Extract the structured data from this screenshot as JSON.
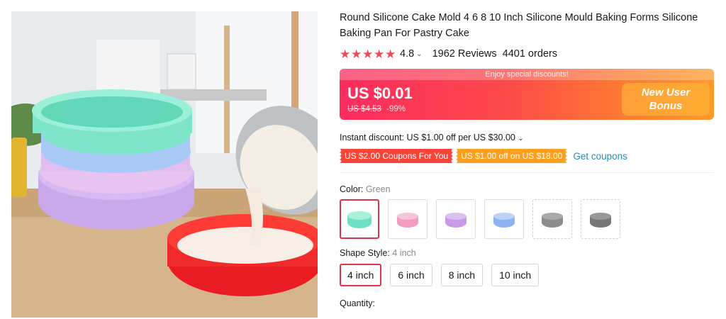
{
  "product": {
    "title": "Round Silicone Cake Mold 4 6 8 10 Inch Silicone Mould Baking Forms Silicone Baking Pan For Pastry Cake",
    "image_alt": "product-photo"
  },
  "rating": {
    "stars": 5,
    "value": "4.8",
    "reviews": "1962 Reviews",
    "orders": "4401 orders"
  },
  "price": {
    "ribbon": "Enjoy special discounts!",
    "current": "US $0.01",
    "original": "US $4.53",
    "discount": "-99%",
    "bonus_line1": "New User",
    "bonus_line2": "Bonus"
  },
  "discounts": {
    "instant": "Instant discount: US $1.00 off per US $30.00",
    "coupon_1": "US $2.00 Coupons For You",
    "coupon_2": "US $1.00 off on US $18.00",
    "get_coupons": "Get coupons"
  },
  "color_option": {
    "label": "Color:",
    "selected": "Green",
    "swatches": [
      {
        "name": "green",
        "color": "#6fe0c4"
      },
      {
        "name": "pink",
        "color": "#f29bc3"
      },
      {
        "name": "purple",
        "color": "#c79be6"
      },
      {
        "name": "blue",
        "color": "#8fb3f0"
      },
      {
        "name": "gray",
        "color": "#8c8c8c"
      },
      {
        "name": "dark-gray",
        "color": "#777777"
      }
    ]
  },
  "shape_option": {
    "label": "Shape Style:",
    "selected": "4 inch",
    "sizes": [
      "4 inch",
      "6 inch",
      "8 inch",
      "10 inch"
    ]
  },
  "quantity": {
    "label": "Quantity:"
  },
  "colors": {
    "accent_red": "#e0334a",
    "star": "#e94b51",
    "link": "#2b8ab6"
  }
}
